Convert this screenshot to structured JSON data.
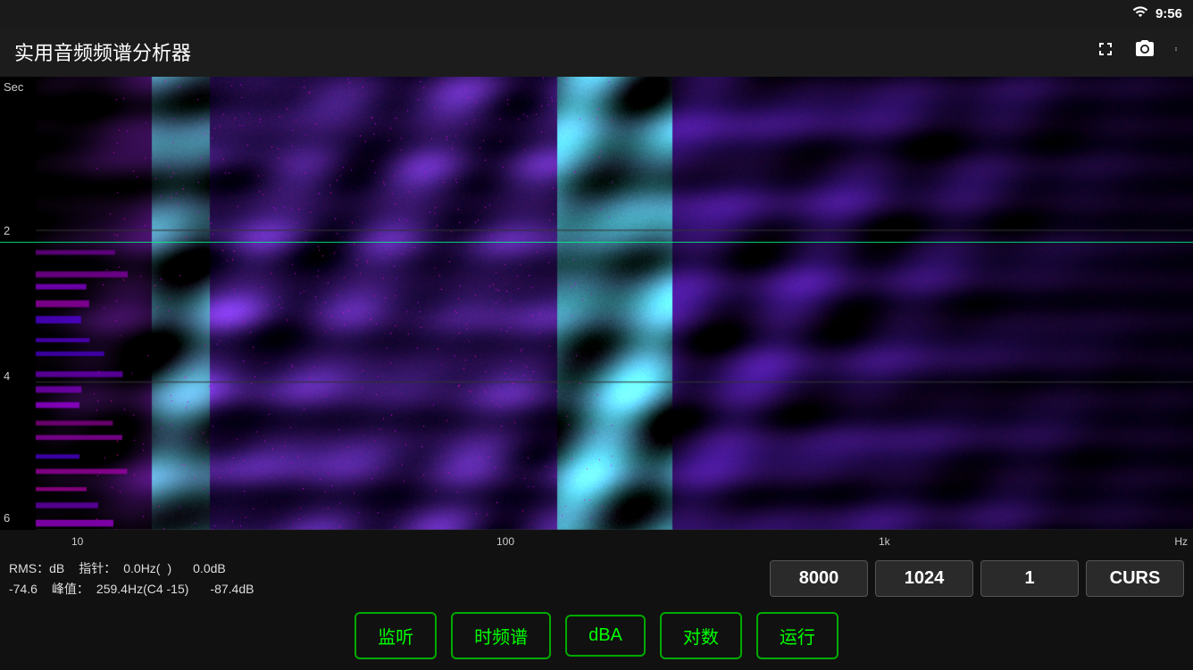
{
  "statusBar": {
    "time": "9:56"
  },
  "appBar": {
    "title": "实用音频频谱分析器",
    "actions": [
      "fullscreen",
      "screenshot",
      "more"
    ]
  },
  "spectrogram": {
    "yAxis": {
      "label": "Sec",
      "ticks": [
        "2",
        "4",
        "6"
      ]
    },
    "xAxis": {
      "ticks": [
        "10",
        "100",
        "1k",
        "Hz"
      ]
    }
  },
  "infoBar": {
    "rmsLabel": "RMS：dB",
    "rmsValue": "-74.6",
    "needleLabel": "指针：",
    "needleHz": "0.0Hz(",
    "needleNote": ")",
    "needledB": "0.0dB",
    "peakLabel": "峰值：",
    "peakHz": "259.4Hz(C4  -15)",
    "peakdB": "-87.4dB",
    "param1": "8000",
    "param2": "1024",
    "param3": "1",
    "paramCurs": "CURS"
  },
  "controls": {
    "btn1": "监听",
    "btn2": "时频谱",
    "btn3": "dBA",
    "btn4": "对数",
    "btn5": "运行"
  }
}
